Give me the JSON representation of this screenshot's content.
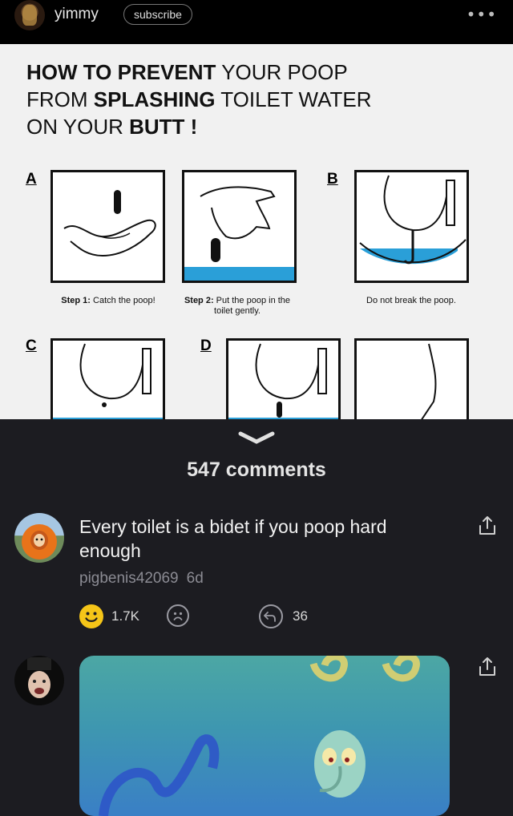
{
  "header": {
    "username": "yimmy",
    "subscribe_label": "subscribe",
    "more_label": "•••"
  },
  "post": {
    "headline": {
      "line1_bold": "HOW TO PREVENT",
      "line1_rest": " YOUR POOP",
      "line2_start": "FROM ",
      "line2_bold": "SPLASHING",
      "line2_rest": " TOILET WATER",
      "line3_start": "ON YOUR ",
      "line3_bold": "BUTT !"
    },
    "panels": {
      "letter_a": "A",
      "letter_b": "B",
      "letter_c": "C",
      "letter_d": "D",
      "step1_bold": "Step 1:",
      "step1_rest": " Catch the poop!",
      "step2_bold": "Step 2:",
      "step2_rest": " Put the poop in the toilet gently.",
      "do_not": "Do not break the poop."
    }
  },
  "comments_section": {
    "count_label": "547 comments"
  },
  "comments": [
    {
      "text": "Every toilet is a bidet if you poop hard enough",
      "author": "pigbenis42069",
      "age": "6d",
      "smile_count": "1.7K",
      "reply_count": "36"
    }
  ],
  "colors": {
    "background": "#1c1c21",
    "smile_yellow": "#f5c518",
    "toilet_water": "#2a9fd8"
  }
}
